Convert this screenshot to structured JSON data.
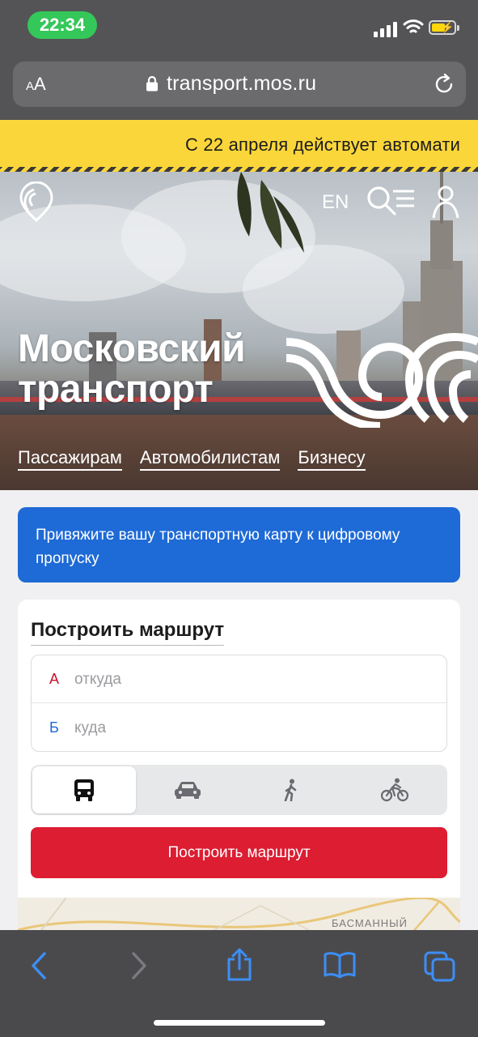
{
  "status_bar": {
    "time": "22:34"
  },
  "browser": {
    "text_size_label": "AA",
    "url": "transport.mos.ru"
  },
  "banner": {
    "text": "С 22 апреля действует автомати"
  },
  "header": {
    "lang": "EN",
    "title_line1": "Московский",
    "title_line2": "транспорт",
    "nav": [
      "Пассажирам",
      "Автомобилистам",
      "Бизнесу"
    ]
  },
  "promo": {
    "text": "Привяжите вашу транспортную карту к цифровому пропуску"
  },
  "route": {
    "title": "Построить маршрут",
    "from_letter": "А",
    "from_placeholder": "откуда",
    "to_letter": "Б",
    "to_placeholder": "куда",
    "modes": [
      {
        "icon": "bus-icon",
        "active": true
      },
      {
        "icon": "car-icon",
        "active": false
      },
      {
        "icon": "walk-icon",
        "active": false
      },
      {
        "icon": "bike-icon",
        "active": false
      }
    ],
    "button": "Построить маршрут"
  },
  "map": {
    "label": "БАСМАННЫЙ"
  },
  "colors": {
    "status_green": "#34c759",
    "banner_yellow": "#fbd63a",
    "promo_blue": "#1e6ad6",
    "button_red": "#dc1d32",
    "from_red": "#c8102e",
    "to_blue": "#1e6ad6",
    "toolbar_blue": "#3d8ef5"
  }
}
